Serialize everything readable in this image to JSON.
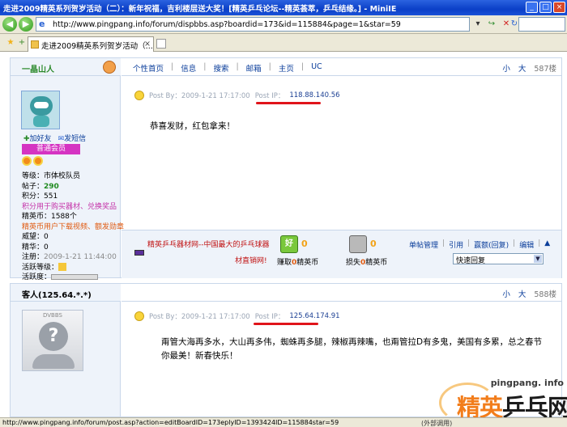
{
  "window": {
    "title": "走进2009精英系列贺岁活动（二）：新年祝福，吉利楼层送大奖！[精英乒乓论坛--精英荟萃，乒乓结缘。] - MiniIE"
  },
  "address": {
    "url": "http://www.pingpang.info/forum/dispbbs.asp?boardid=173&id=115884&page=1&star=59"
  },
  "tab": {
    "label": "走进2009精英系列贺岁活动（..."
  },
  "post1": {
    "username": "一晶山人",
    "menu": [
      "个性首页",
      "信息",
      "搜索",
      "邮箱",
      "主页",
      "UC"
    ],
    "font_small": "小",
    "font_large": "大",
    "floor": "587楼",
    "add_friend": "加好友",
    "send_message": "发短信",
    "member_badge": "普通会员",
    "stats": {
      "level": "等级：市体校队员",
      "posts_label": "帖子：",
      "posts_value": "290",
      "points": "积分：551",
      "points_note": "积分用于购买器材、兑换奖品",
      "coins": "精英币：1588个",
      "coins_note": "精英币用户下载视频、额发勋章",
      "prestige": "威望：0",
      "essence": "精华：0",
      "registered": "注册：",
      "registered_value": "2009-1-21 11:44:00",
      "activity_level": "活跃等级：",
      "activity": "活跃度："
    },
    "meta_by": "Post By：2009-1-21 17:17:00",
    "meta_ip_label": "Post IP：",
    "ip": "118.88.140.56",
    "content": "恭喜发财，红包拿来！",
    "signature_link": "精英乒乓器材网--中国最大的乒乓球器",
    "signature_link2": "材直销网!",
    "good_count": "0",
    "good_label_pre": "赚取",
    "good_label_num": "0",
    "good_label_post": "精英币",
    "bad_count": "0",
    "bad_label_pre": "损失",
    "bad_label_num": "0",
    "bad_label_post": "精英币",
    "manage": [
      "单帖管理",
      "引用",
      "赢额(回复)",
      "编辑"
    ],
    "quick_reply": "快速回复"
  },
  "post2": {
    "username": "客人(125.64.*.*)",
    "font_small": "小",
    "font_large": "大",
    "floor": "588楼",
    "avatar_label": "DVBBS",
    "meta_by": "Post By：2009-1-21 17:17:00",
    "meta_ip_label": "Post IP：",
    "ip": "125.64.174.91",
    "content_line1": "甭管大海再多水，大山再多伟，蜘蛛再多腿，辣椒再辣嘴，也甭管拉D有多鬼，美国有多累，总之春节",
    "content_line2": "你最美！新春快乐！"
  },
  "watermark": {
    "site": "pingpang. info",
    "logo_a": "精英",
    "logo_b": "乒乓网"
  },
  "status": {
    "url": "http://www.pingpang.info/forum/post.asp?action=editBoardID=173eplyID=1393424ID=115884star=59",
    "right": "(外部调用)"
  },
  "colors": {
    "accent": "#0b3e9b",
    "ip_underline": "#e0141a",
    "badge": "#d534c2"
  }
}
